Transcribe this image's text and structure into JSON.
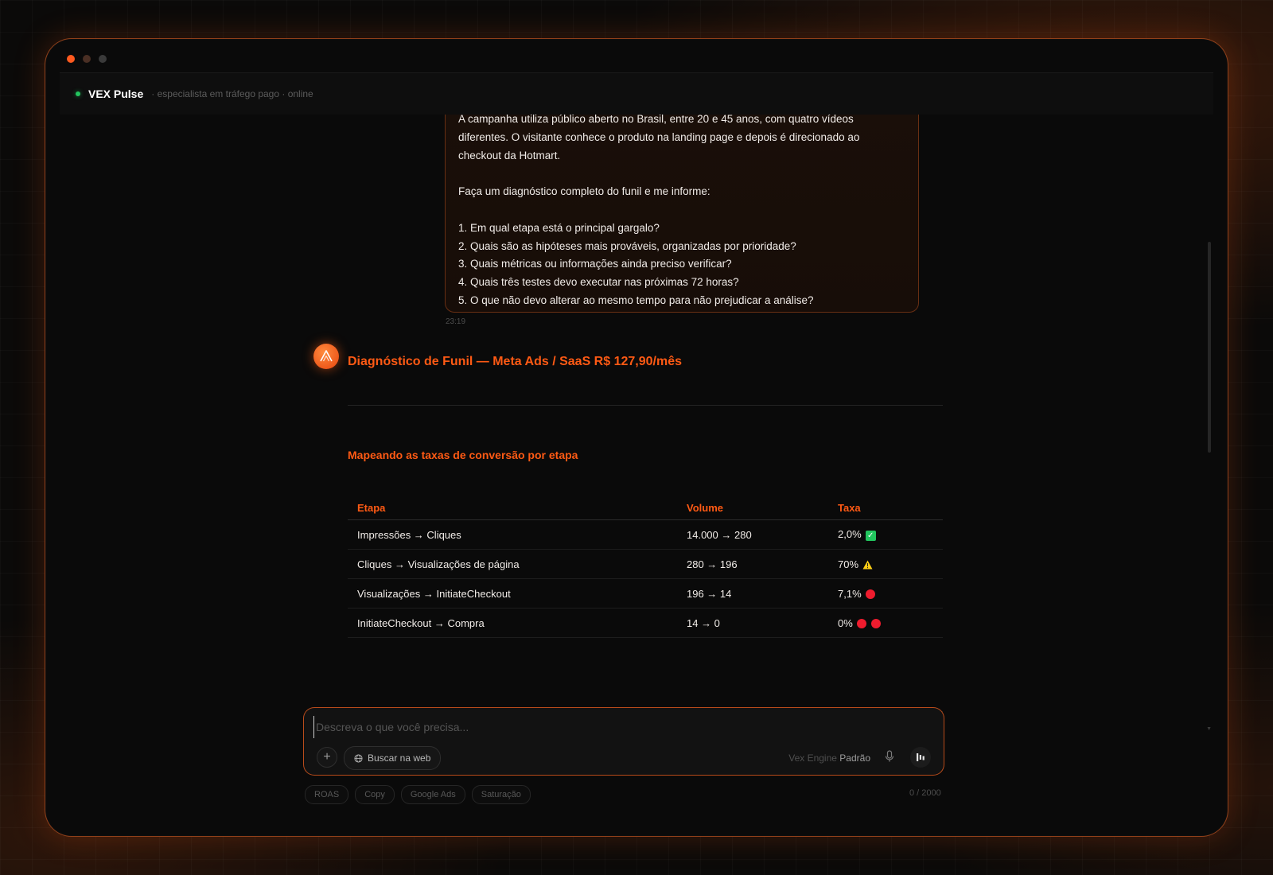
{
  "header": {
    "app_name": "VEX Pulse",
    "subtitle": "· especialista em tráfego pago · online",
    "status_color": "#22c55e"
  },
  "user_message": {
    "lines": [
      "A campanha utiliza público aberto no Brasil, entre 20 e 45 anos, com quatro vídeos",
      "diferentes. O visitante conhece o produto na landing page e depois é direcionado ao",
      "checkout da Hotmart.",
      "Faça um diagnóstico completo do funil e me informe:",
      "1. Em qual etapa está o principal gargalo?",
      "2. Quais são as hipóteses mais prováveis, organizadas por prioridade?",
      "3. Quais métricas ou informações ainda preciso verificar?",
      "4. Quais três testes devo executar nas próximas 72 horas?",
      "5. O que não devo alterar ao mesmo tempo para não prejudicar a análise?"
    ],
    "time": "23:19"
  },
  "response": {
    "title": "Diagnóstico de Funil — Meta Ads / SaaS R$ 127,90/mês",
    "section_title": "Mapeando as taxas de conversão por etapa",
    "table": {
      "headers": [
        "Etapa",
        "Volume",
        "Taxa"
      ],
      "rows": [
        {
          "etapa": "Impressões → Cliques",
          "volume": "14.000 → 280",
          "taxa": "2,0%",
          "status": "check-icon"
        },
        {
          "etapa": "Cliques → Visualizações de página",
          "volume": "280 → 196",
          "taxa": "70%",
          "status": "warning-icon"
        },
        {
          "etapa": "Visualizações → InitiateCheckout",
          "volume": "196 → 14",
          "taxa": "7,1%",
          "status": "red-circle-icon"
        },
        {
          "etapa": "InitiateCheckout → Compra",
          "volume": "14 → 0",
          "taxa": "0%",
          "status": "double-red-circle-icon"
        }
      ]
    }
  },
  "composer": {
    "placeholder": "Descreva o que você precisa...",
    "web_search_label": "Buscar na web",
    "engine_label": "Vex Engine",
    "engine_value": "Padrão",
    "char_counter": "0 / 2000"
  },
  "quick_chips": [
    "ROAS",
    "Copy",
    "Google Ads",
    "Saturação"
  ],
  "colors": {
    "accent": "#ff5a14",
    "ok": "#22c55e",
    "warn": "#facc15",
    "error": "#ef1c2e"
  }
}
